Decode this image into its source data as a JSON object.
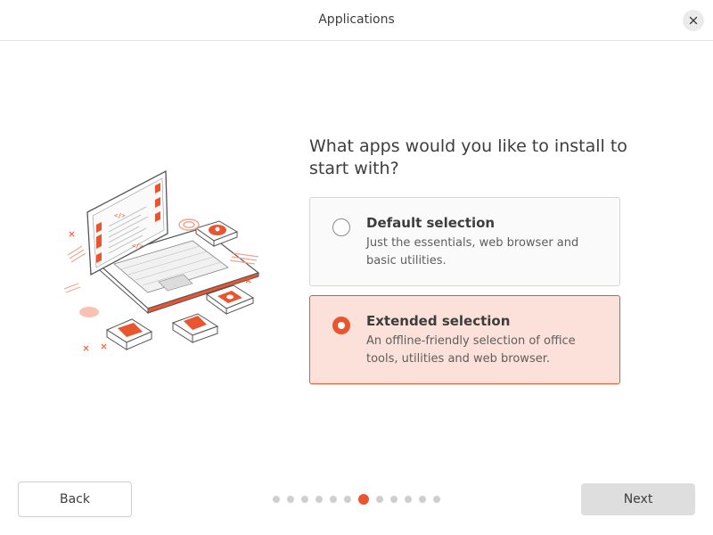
{
  "window": {
    "title": "Applications",
    "close_icon": "close-icon"
  },
  "illustration": {
    "icon": "laptop-apps-illustration"
  },
  "main": {
    "question": "What apps would you like to install to start with?",
    "options": [
      {
        "title": "Default selection",
        "description": "Just the essentials, web browser and basic utilities.",
        "selected": false
      },
      {
        "title": "Extended selection",
        "description": "An offline-friendly selection of office tools, utilities and web browser.",
        "selected": true
      }
    ]
  },
  "footer": {
    "back_label": "Back",
    "next_label": "Next",
    "progress": {
      "total_steps": 12,
      "current_step": 7
    }
  },
  "colors": {
    "accent": "#e9552f",
    "selected_bg": "#fbe1da",
    "dot_inactive": "#cfcfcf"
  }
}
